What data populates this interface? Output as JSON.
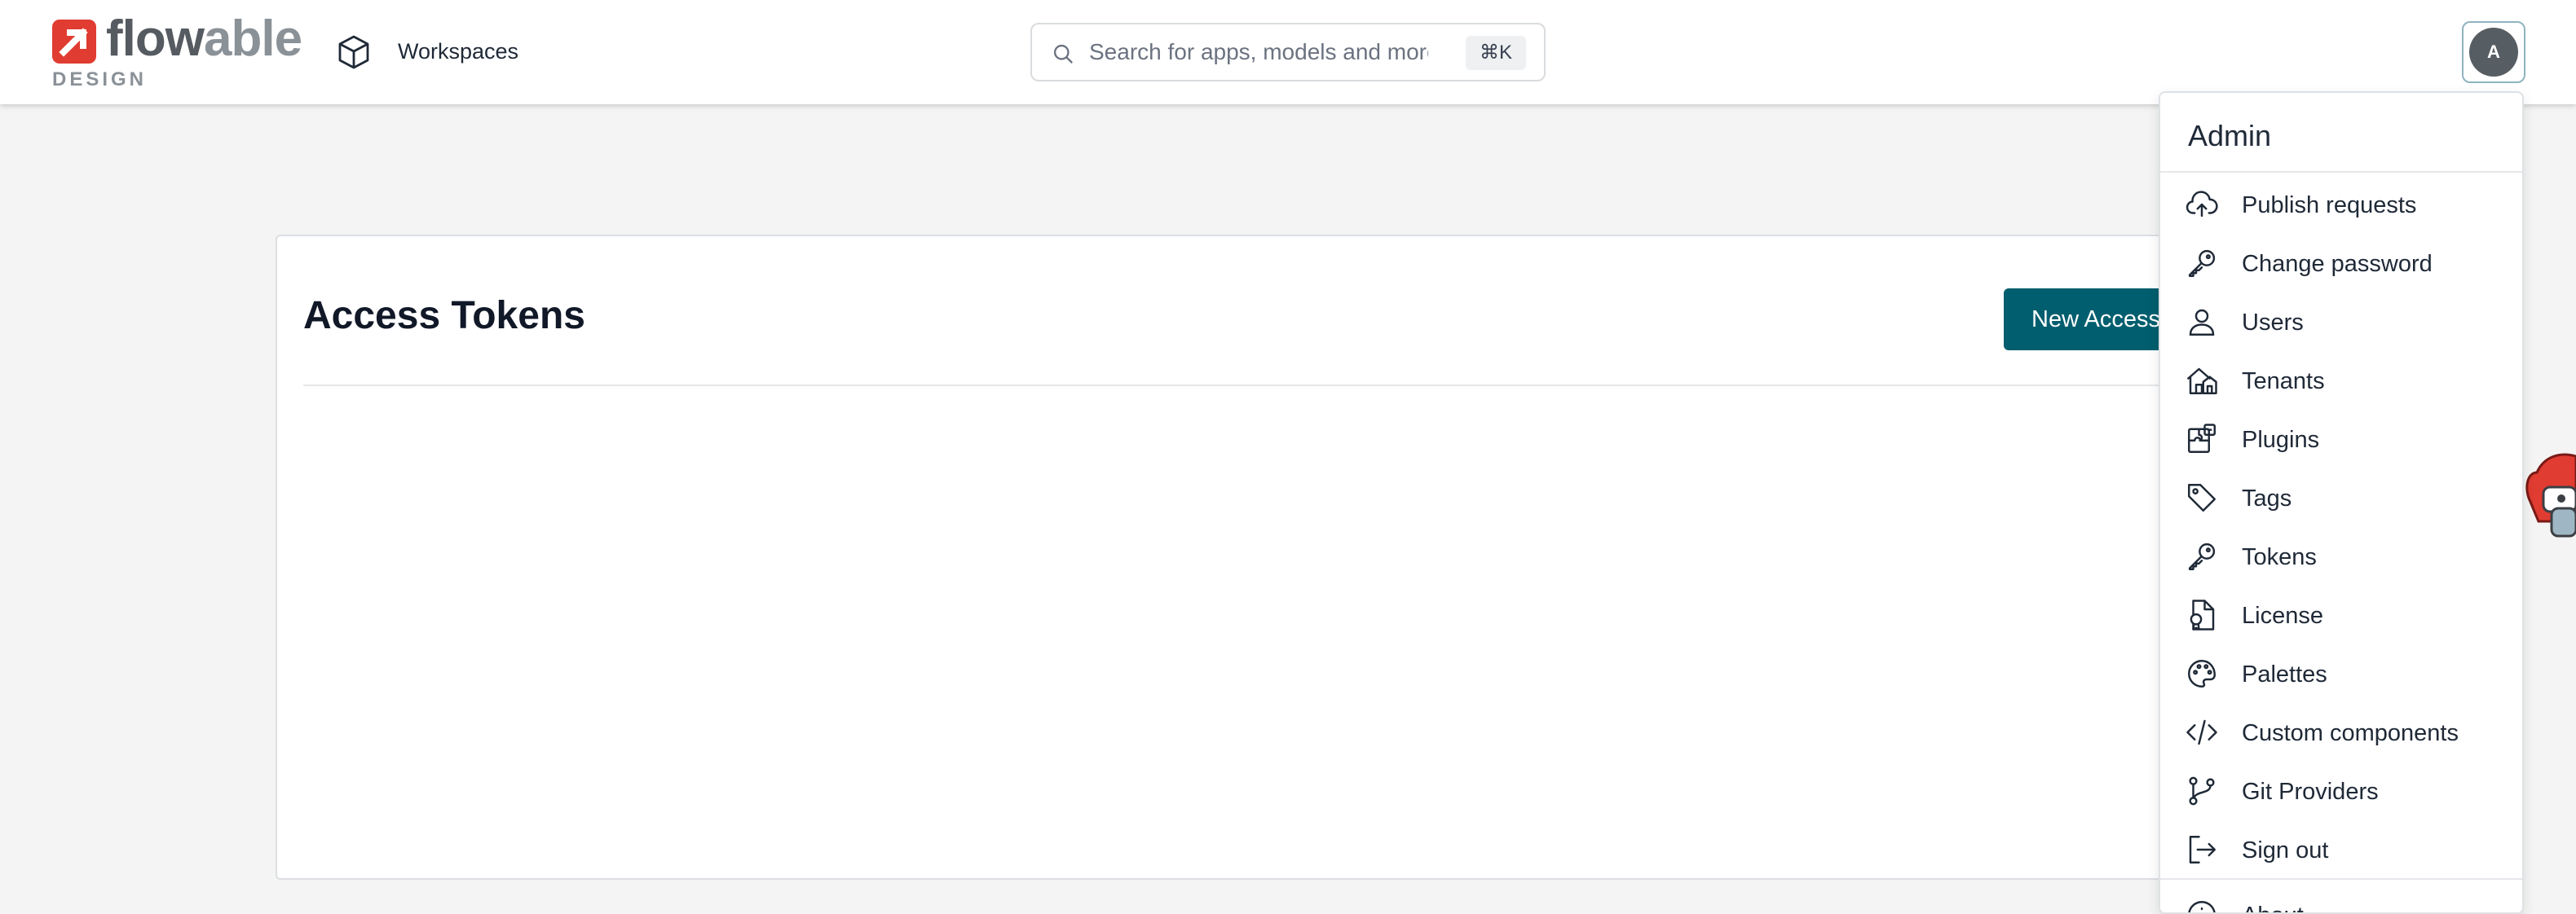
{
  "header": {
    "logo": {
      "word_bold": "flow",
      "word_light": "able",
      "sub": "DESIGN"
    },
    "workspaces_label": "Workspaces",
    "search": {
      "placeholder": "Search for apps, models and more",
      "shortcut": "⌘K"
    },
    "avatar_initial": "A"
  },
  "main": {
    "title": "Access Tokens",
    "new_button_label": "New Access Token"
  },
  "dropdown": {
    "title": "Admin",
    "items": [
      {
        "label": "Publish requests",
        "icon": "cloud-upload-icon"
      },
      {
        "label": "Change password",
        "icon": "key-icon"
      },
      {
        "label": "Users",
        "icon": "user-icon"
      },
      {
        "label": "Tenants",
        "icon": "houses-icon"
      },
      {
        "label": "Plugins",
        "icon": "puzzle-icon"
      },
      {
        "label": "Tags",
        "icon": "tag-icon"
      },
      {
        "label": "Tokens",
        "icon": "key-icon"
      },
      {
        "label": "License",
        "icon": "license-icon"
      },
      {
        "label": "Palettes",
        "icon": "palette-icon"
      },
      {
        "label": "Custom components",
        "icon": "code-icon"
      },
      {
        "label": "Git Providers",
        "icon": "git-branch-icon"
      },
      {
        "label": "Sign out",
        "icon": "sign-out-icon"
      },
      {
        "label": "About",
        "icon": "info-icon"
      }
    ]
  },
  "colors": {
    "brand_red": "#e03c31",
    "primary_teal": "#005e6e",
    "avatar_gray": "#575e63"
  }
}
